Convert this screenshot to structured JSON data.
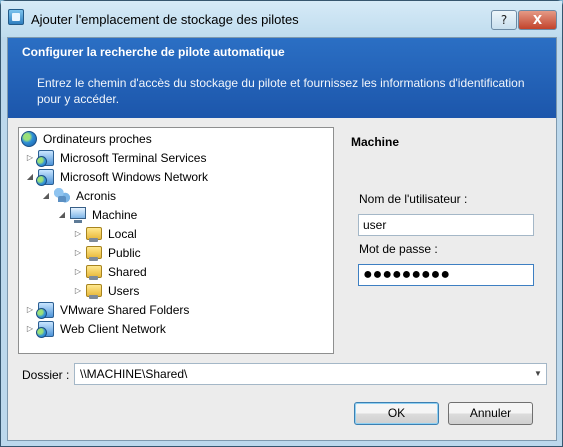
{
  "window": {
    "title": "Ajouter l'emplacement de stockage des pilotes",
    "help_label": "?",
    "close_label": "X"
  },
  "banner": {
    "title": "Configurer la recherche de pilote automatique",
    "description": "Entrez le chemin d'accès du stockage du pilote et fournissez les informations d'identification pour y accéder."
  },
  "tree": {
    "items": [
      {
        "label": "Ordinateurs proches",
        "icon": "globe-icon",
        "expander": ""
      },
      {
        "label": "Microsoft Terminal Services",
        "icon": "network-icon",
        "expander": "▷"
      },
      {
        "label": "Microsoft Windows Network",
        "icon": "network-icon",
        "expander": "◢"
      },
      {
        "label": "Acronis",
        "icon": "workgroup-icon",
        "expander": "◢"
      },
      {
        "label": "Machine",
        "icon": "computer-icon",
        "expander": "◢"
      },
      {
        "label": "Local",
        "icon": "shared-folder-icon",
        "expander": "▷"
      },
      {
        "label": "Public",
        "icon": "shared-folder-icon",
        "expander": "▷"
      },
      {
        "label": "Shared",
        "icon": "shared-folder-icon",
        "expander": "▷"
      },
      {
        "label": "Users",
        "icon": "shared-folder-icon",
        "expander": "▷"
      },
      {
        "label": "VMware Shared Folders",
        "icon": "network-icon",
        "expander": "▷"
      },
      {
        "label": "Web Client Network",
        "icon": "network-icon",
        "expander": "▷"
      }
    ]
  },
  "details": {
    "section_title": "Machine",
    "username_label": "Nom de l'utilisateur :",
    "username_value": "user",
    "password_label": "Mot de passe :",
    "password_value": "●●●●●●●●●"
  },
  "folder": {
    "label": "Dossier :",
    "value": "\\\\MACHINE\\Shared\\"
  },
  "buttons": {
    "ok": "OK",
    "cancel": "Annuler"
  }
}
